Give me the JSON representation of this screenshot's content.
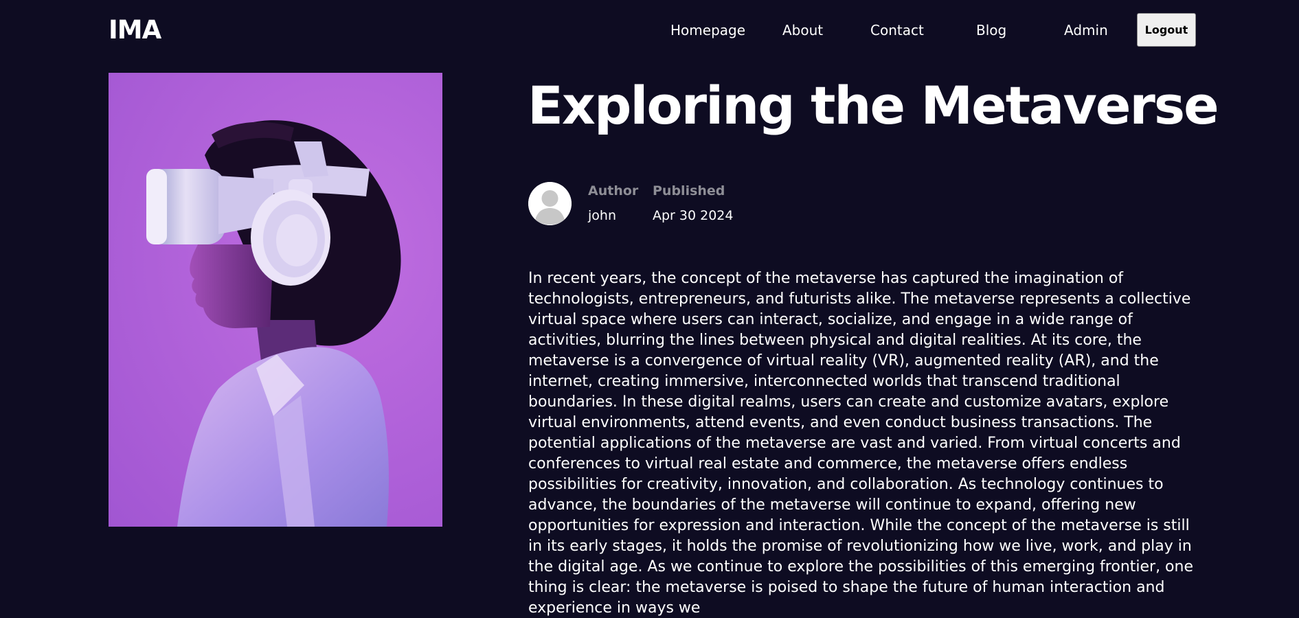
{
  "header": {
    "logo": "IMA",
    "nav": [
      {
        "label": "Homepage"
      },
      {
        "label": "About"
      },
      {
        "label": "Contact"
      },
      {
        "label": "Blog"
      },
      {
        "label": "Admin"
      }
    ],
    "logout_label": "Logout"
  },
  "post": {
    "title": "Exploring the Metaverse",
    "author_label": "Author",
    "author": "john",
    "published_label": "Published",
    "published_date": "Apr 30 2024",
    "body": "In recent years, the concept of the metaverse has captured the imagination of technologists, entrepreneurs, and futurists alike. The metaverse represents a collective virtual space where users can interact, socialize, and engage in a wide range of activities, blurring the lines between physical and digital realities. At its core, the metaverse is a convergence of virtual reality (VR), augmented reality (AR), and the internet, creating immersive, interconnected worlds that transcend traditional boundaries. In these digital realms, users can create and customize avatars, explore virtual environments, attend events, and even conduct business transactions. The potential applications of the metaverse are vast and varied. From virtual concerts and conferences to virtual real estate and commerce, the metaverse offers endless possibilities for creativity, innovation, and collaboration. As technology continues to advance, the boundaries of the metaverse will continue to expand, offering new opportunities for expression and interaction. While the concept of the metaverse is still in its early stages, it holds the promise of revolutionizing how we live, work, and play in the digital age. As we continue to explore the possibilities of this emerging frontier, one thing is clear: the metaverse is poised to shape the future of human interaction and experience in ways we"
  },
  "colors": {
    "background": "#0e0c22",
    "hero_background": "#b263da",
    "meta_label": "#8e8e96",
    "button_bg": "#efefef"
  },
  "icons": {
    "avatar": "default-user-avatar-icon",
    "hero": "vr-headset-person-photo"
  }
}
